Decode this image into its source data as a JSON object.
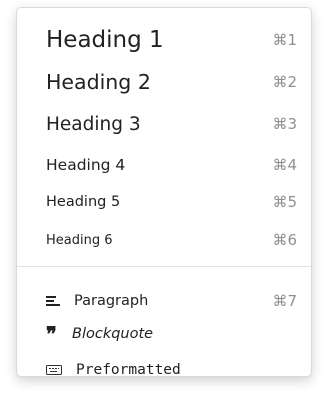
{
  "menu": {
    "headings": [
      {
        "label": "Heading 1",
        "shortcut": "⌘1"
      },
      {
        "label": "Heading 2",
        "shortcut": "⌘2"
      },
      {
        "label": "Heading 3",
        "shortcut": "⌘3"
      },
      {
        "label": "Heading 4",
        "shortcut": "⌘4"
      },
      {
        "label": "Heading 5",
        "shortcut": "⌘5"
      },
      {
        "label": "Heading 6",
        "shortcut": "⌘6"
      }
    ],
    "paragraph": {
      "label": "Paragraph",
      "shortcut": "⌘7",
      "icon": "paragraph-icon"
    },
    "blockquote": {
      "label": "Blockquote",
      "icon": "quote-icon"
    },
    "preformatted": {
      "label": "Preformatted",
      "icon": "keyboard-icon"
    }
  },
  "colors": {
    "text": "#222222",
    "shortcut": "#8f8f8f",
    "border": "#d9d9d9",
    "divider": "#e2e2e2"
  }
}
